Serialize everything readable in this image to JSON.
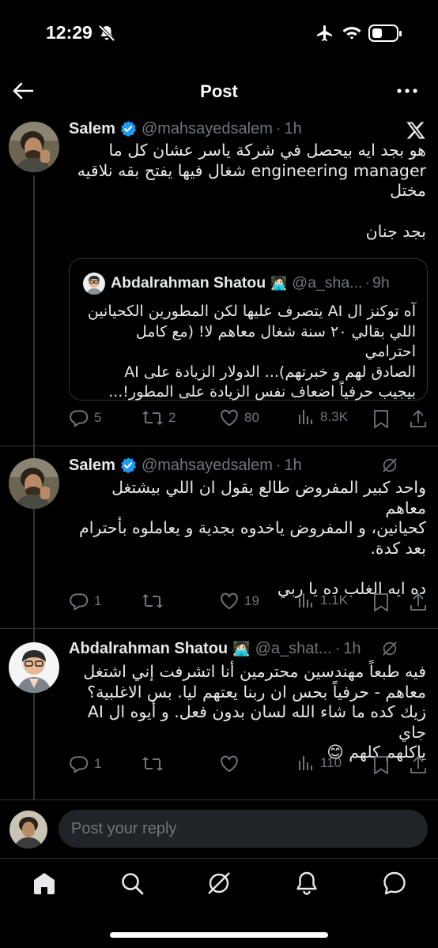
{
  "status_bar": {
    "time": "12:29"
  },
  "header": {
    "title": "Post"
  },
  "main_tweet": {
    "name": "Salem",
    "handle": "@mahsayedsalem",
    "time": "1h",
    "text_lines": [
      "هو بجد ايه بيحصل في شركة ياسر عشان كل ما",
      "engineering manager شغال فيها يفتح بقه نلاقيه",
      "مختل"
    ],
    "text_line2": "بجد جنان",
    "quote": {
      "name": "Abdalrahman Shatou",
      "emoji": "🧑🏻‍💻",
      "handle": "@a_sha...",
      "time": "9h",
      "text_lines": [
        "آه توكنز ال AI يتصرف عليها لكن المطورين الكحيانين",
        "اللي بقالي ٢٠ سنة شغال معاهم لا! (مع كامل احترامي",
        "الصادق لهم و خبرتهم)... الدولار الزيادة على AI",
        "بيجيب حرفياً اضعاف نفس الزيادة على المطور!..."
      ]
    },
    "stats": {
      "replies": "5",
      "reposts": "2",
      "likes": "80",
      "views": "8.3K"
    }
  },
  "reply1": {
    "name": "Salem",
    "handle": "@mahsayedsalem",
    "time": "1h",
    "text_lines": [
      "واحد كبير المفروض طالع يقول ان اللي بيشتغل معاهم",
      "كحيانين، و المفروض ياخدوه بجدية و يعاملوه بأحترام",
      "بعد كدة."
    ],
    "text_line2": "ده ايه الغلب ده يا ربي",
    "stats": {
      "replies": "1",
      "likes": "19",
      "views": "1.1K"
    }
  },
  "reply2": {
    "name": "Abdalrahman Shatou",
    "emoji": "🧑🏻‍💻",
    "handle": "@a_shat...",
    "time": "1h",
    "text_lines": [
      "فيه طبعاً مهندسين محترمين أنا اتشرفت إني اشتغل",
      "معاهم - حرفياً بحس ان ربنا يعتهم ليا. بس الاغلبية؟",
      "زيك كده ما شاء الله لسان بدون فعل. و أيوه ال AI جاي",
      "ياكلهم كلهم 😊"
    ],
    "stats": {
      "replies": "1",
      "views": "110"
    }
  },
  "reply_bar": {
    "placeholder": "Post your reply"
  },
  "colors": {
    "background": "#000000",
    "text": "#e7e9ea",
    "muted": "#71767b",
    "verified": "#1d9bf0",
    "divider": "#2f3336"
  }
}
